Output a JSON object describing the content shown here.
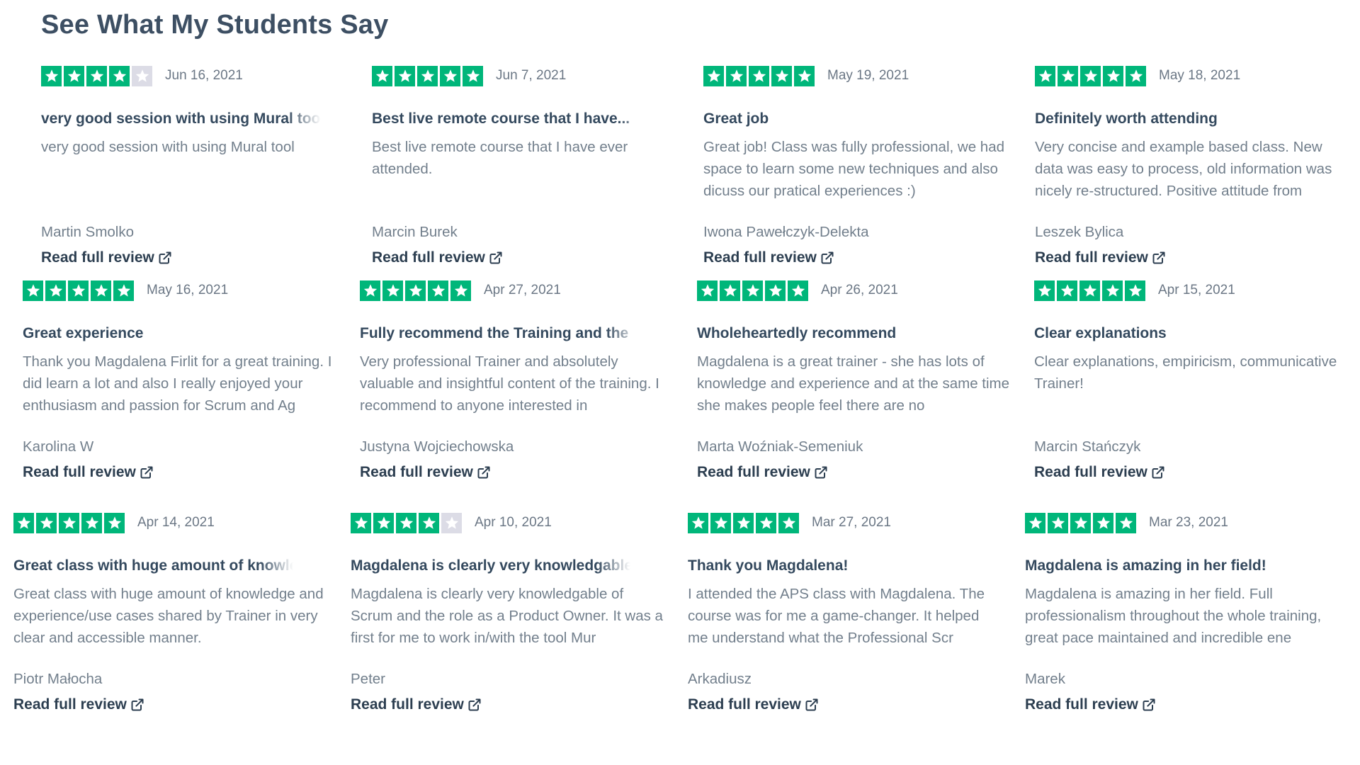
{
  "section_title": "See What My Students Say",
  "link_label": "Read full review",
  "colors": {
    "star_green": "#00b67a",
    "star_empty": "#dcdce6",
    "title": "#3d4f63",
    "muted_text": "#727f8c"
  },
  "reviews": [
    {
      "stars": 4,
      "date": "Jun 16, 2021",
      "title": "very good session with using Mural tool",
      "body": "very good session with using Mural tool",
      "author": "Martin Smolko"
    },
    {
      "stars": 5,
      "date": "Jun 7, 2021",
      "title": "Best live remote course that I have...",
      "body": "Best live remote course that I have ever attended.",
      "author": "Marcin Burek"
    },
    {
      "stars": 5,
      "date": "May 19, 2021",
      "title": "Great job",
      "body": "Great job! Class was fully professional, we had space to learn some new techniques and also dicuss our pratical experiences :)",
      "author": "Iwona Pawełczyk-Delekta"
    },
    {
      "stars": 5,
      "date": "May 18, 2021",
      "title": "Definitely worth attending",
      "body": "Very concise and example based class. New data was easy to process, old information was nicely re-structured. Positive attitude from",
      "author": "Leszek Bylica"
    },
    {
      "stars": 5,
      "date": "May 16, 2021",
      "title": "Great experience",
      "body": "Thank you Magdalena Firlit for a great training. I did learn a lot and also I really enjoyed your enthusiasm and passion for Scrum and Ag",
      "author": "Karolina W"
    },
    {
      "stars": 5,
      "date": "Apr 27, 2021",
      "title": "Fully recommend the Training and the",
      "body": "Very professional Trainer and absolutely valuable and insightful content of the training. I recommend to anyone interested in",
      "author": "Justyna Wojciechowska"
    },
    {
      "stars": 5,
      "date": "Apr 26, 2021",
      "title": "Wholeheartedly recommend",
      "body": "Magdalena is a great trainer - she has lots of knowledge and experience and at the same time she makes people feel there are no",
      "author": "Marta Woźniak-Semeniuk"
    },
    {
      "stars": 5,
      "date": "Apr 15, 2021",
      "title": "Clear explanations",
      "body": "Clear explanations, empiricism, communicative Trainer!",
      "author": "Marcin Stańczyk"
    },
    {
      "stars": 5,
      "date": "Apr 14, 2021",
      "title": "Great class with huge amount of knowle",
      "body": "Great class with huge amount of knowledge and experience/use cases shared by Trainer in very clear and accessible manner.",
      "author": "Piotr Małocha"
    },
    {
      "stars": 4,
      "date": "Apr 10, 2021",
      "title": "Magdalena is clearly very knowledgable",
      "body": "Magdalena is clearly very knowledgable of Scrum and the role as a Product Owner. It was a first for me to work in/with the tool Mur",
      "author": "Peter"
    },
    {
      "stars": 5,
      "date": "Mar 27, 2021",
      "title": "Thank you Magdalena!",
      "body": "I attended the APS class with Magdalena. The course was for me a game-changer. It helped me understand what the Professional Scr",
      "author": "Arkadiusz"
    },
    {
      "stars": 5,
      "date": "Mar 23, 2021",
      "title": "Magdalena is amazing in her field!",
      "body": "Magdalena is amazing in her field. Full professionalism throughout the whole training, great pace maintained and incredible ene",
      "author": "Marek"
    }
  ]
}
